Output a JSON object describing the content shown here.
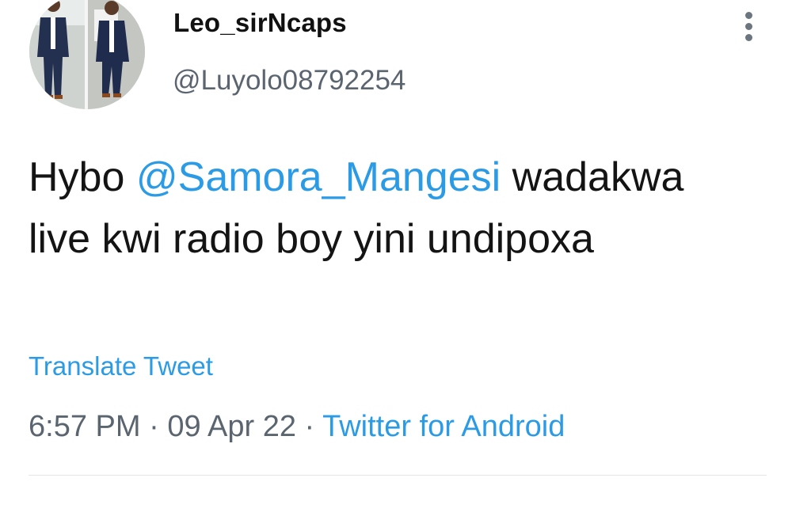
{
  "tweet": {
    "display_name": "Leo_sirNcaps",
    "handle": "@Luyolo08792254",
    "text_before": "Hybo ",
    "mention": "@Samora_Mangesi",
    "text_after": " wadakwa live kwi radio boy yini undipoxa",
    "translate_label": "Translate Tweet",
    "time": "6:57 PM",
    "date": "09 Apr 22",
    "separator": " · ",
    "source": "Twitter for Android"
  },
  "icons": {
    "more": "more-vertical-icon"
  },
  "colors": {
    "link": "#2b9be6",
    "secondary_text": "#5b6570",
    "primary_text": "#141414"
  }
}
